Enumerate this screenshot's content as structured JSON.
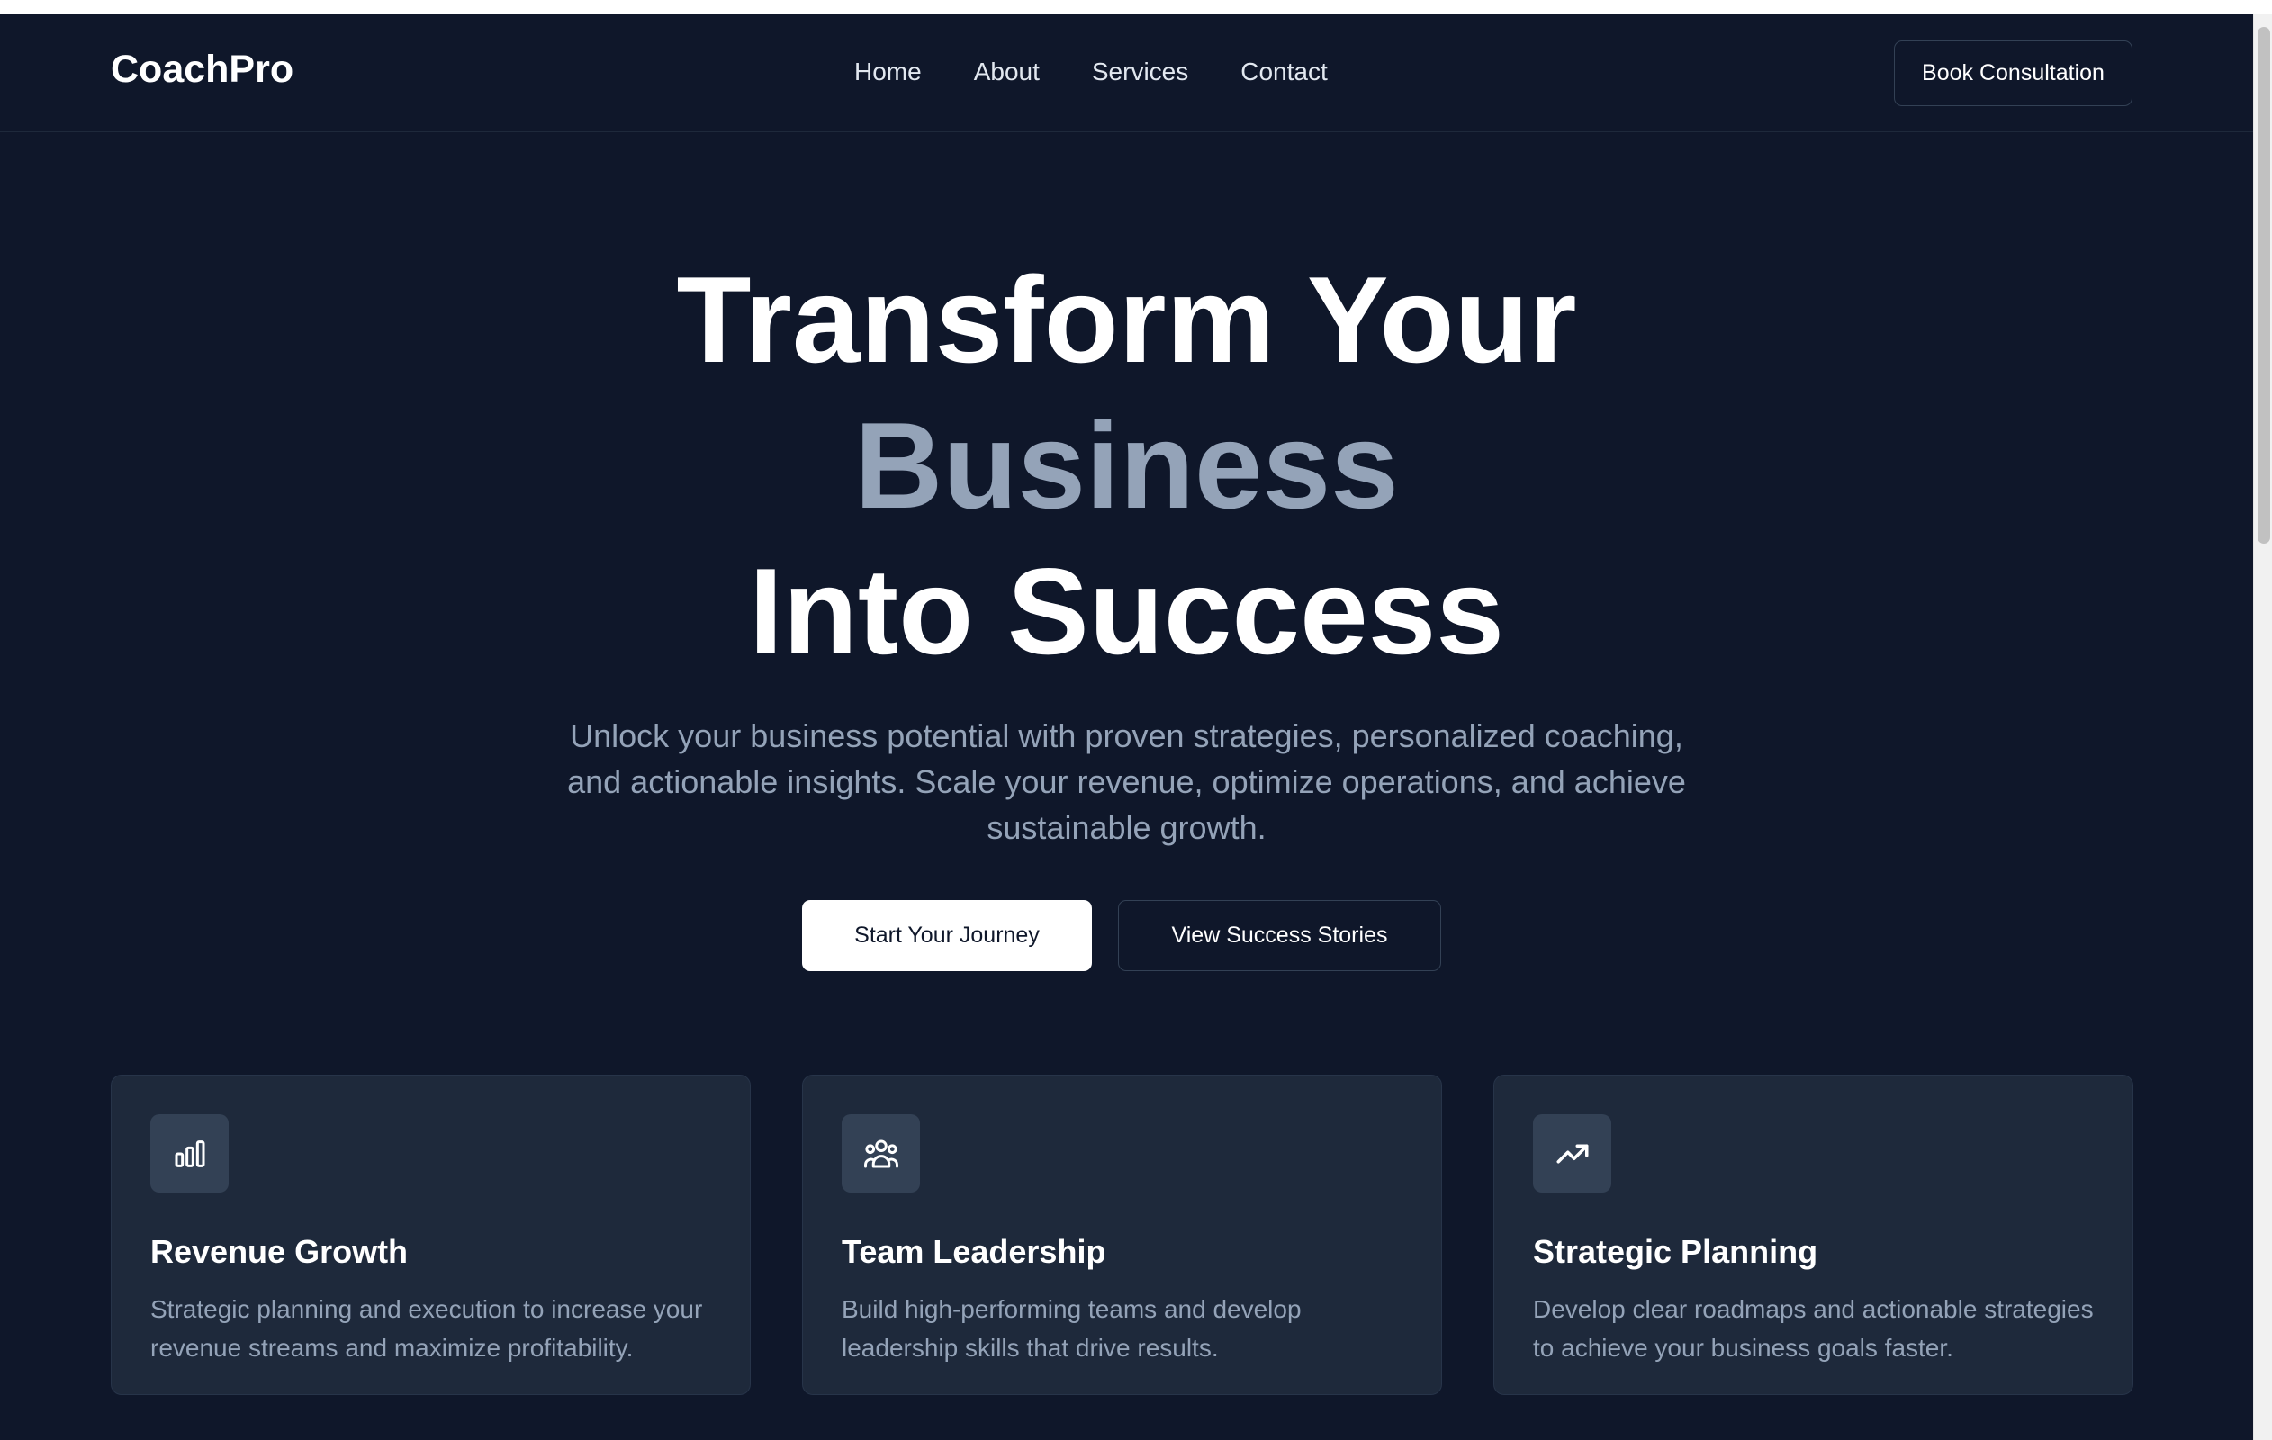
{
  "header": {
    "logo": "CoachPro",
    "nav": [
      "Home",
      "About",
      "Services",
      "Contact"
    ],
    "cta_label": "Book Consultation"
  },
  "hero": {
    "title_line1": "Transform Your",
    "title_accent": "Business",
    "title_line3": "Into Success",
    "subtitle": "Unlock your business potential with proven strategies, personalized coaching, and actionable insights. Scale your revenue, optimize operations, and achieve sustainable growth.",
    "primary_button": "Start Your Journey",
    "secondary_button": "View Success Stories"
  },
  "features": [
    {
      "icon": "bar-chart-icon",
      "title": "Revenue Growth",
      "description": "Strategic planning and execution to increase your revenue streams and maximize profitability."
    },
    {
      "icon": "users-icon",
      "title": "Team Leadership",
      "description": "Build high-performing teams and develop leadership skills that drive results."
    },
    {
      "icon": "trending-up-icon",
      "title": "Strategic Planning",
      "description": "Develop clear roadmaps and actionable strategies to achieve your business goals faster."
    }
  ],
  "colors": {
    "background": "#0f172a",
    "card": "#1e293b",
    "icon_tile": "#334155",
    "accent_text": "#94a3b8",
    "primary": "#ffffff"
  }
}
